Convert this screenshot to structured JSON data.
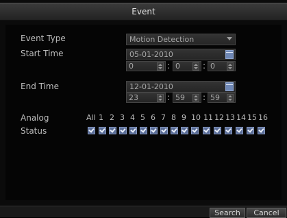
{
  "window": {
    "title": "Event"
  },
  "form": {
    "event_type_label": "Event Type",
    "event_type_value": "Motion Detection",
    "start_time_label": "Start Time",
    "start_date": "05-01-2010",
    "start_hour": "0",
    "start_minute": "0",
    "start_second": "0",
    "end_time_label": "End Time",
    "end_date": "12-01-2010",
    "end_hour": "23",
    "end_minute": "59",
    "end_second": "59",
    "time_separator": ":"
  },
  "analog": {
    "label": "Analog",
    "status_label": "Status",
    "all_label": "All",
    "channels": [
      "1",
      "2",
      "3",
      "4",
      "5",
      "6",
      "7",
      "8",
      "9",
      "10",
      "11",
      "12",
      "13",
      "14",
      "15",
      "16"
    ],
    "checked": [
      true,
      true,
      true,
      true,
      true,
      true,
      true,
      true,
      true,
      true,
      true,
      true,
      true,
      true,
      true,
      true,
      true
    ]
  },
  "footer": {
    "search_label": "Search",
    "cancel_label": "Cancel"
  },
  "colors": {
    "checkbox": "#5a6d97",
    "calendar": "#6f88b6",
    "background": "#050505"
  }
}
